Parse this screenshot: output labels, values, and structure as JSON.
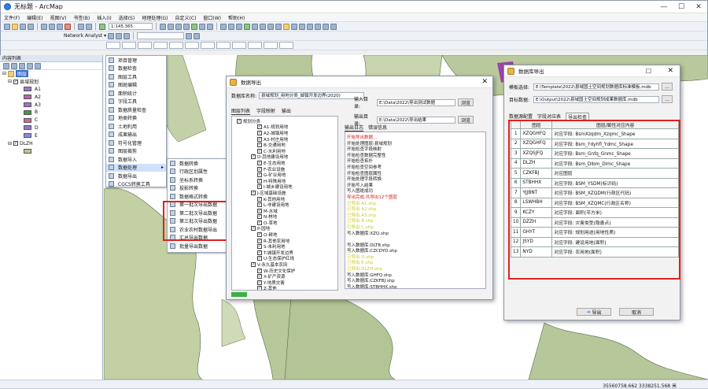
{
  "app": {
    "title": "无标题 - ArcMap",
    "window_buttons": [
      "—",
      "☐",
      "✕"
    ]
  },
  "menubar": [
    "文件(F)",
    "编辑(E)",
    "视图(V)",
    "书签(B)",
    "插入(I)",
    "选择(S)",
    "地理处理(G)",
    "自定义(C)",
    "窗口(W)",
    "帮助(H)"
  ],
  "toolbar": {
    "scale": "1:145,365",
    "network_analyst": "Network Analyst ▾"
  },
  "toc": {
    "header": "内容列表",
    "layers_group": "图层",
    "layer1": "县域规划",
    "classes": [
      {
        "label": "A1",
        "color": "#9b77c7"
      },
      {
        "label": "A2",
        "color": "#c061b7"
      },
      {
        "label": "A3",
        "color": "#9e6fd3"
      },
      {
        "label": "B",
        "color": "#3f9c43"
      },
      {
        "label": "C",
        "color": "#d06aa3"
      },
      {
        "label": "D",
        "color": "#9f73c5"
      },
      {
        "label": "E",
        "color": "#8e8bd6"
      }
    ],
    "layer2": "DLZH"
  },
  "context_menu1": {
    "items": [
      "项目管理",
      "数据检查",
      "图层工具",
      "图斑编辑",
      "面积统计",
      "字段工具",
      "数据质量检查",
      "地类转换",
      "土地利用",
      "成果输出",
      "符号化管理",
      "图层裁剪",
      "数据导入",
      "数据处理",
      "数据导出",
      "CGCS转换工具"
    ]
  },
  "context_menu2": {
    "items": [
      "数据转换",
      "行政区划属性",
      "坐标系转换",
      "投影转换",
      "数据格式转换",
      "第一批次导出数据",
      "第二批次导出数据",
      "第三批次导出数据",
      "农业农村数据导出",
      "汇总导出数据",
      "批量导出数据"
    ]
  },
  "dialog1": {
    "title": "数据导出",
    "fields": [
      {
        "label": "数据库名称:",
        "value": "县域规划_用地分类_城镇开发边界(2020)"
      },
      {
        "label": "输入目录:",
        "value": "E:\\Data\\2022\\导出测试数据"
      },
      {
        "label": "输出目录:",
        "value": "E:\\Data\\2022\\导出结果"
      }
    ],
    "browse": "浏览",
    "tabs": [
      "图层列表",
      "字段映射",
      "输出"
    ],
    "tree_items": [
      "规划分类",
      "A1-规划用地",
      "A2-城镇用地",
      "A3-村庄用地",
      "B-交通用地",
      "C-水利用地",
      "D-其他建设用地",
      "E-生态用地",
      "F-农业设施",
      "G-矿业用地",
      "H-特殊用地",
      "I-城乡建设用地",
      "J-区域基础设施",
      "K-其他用地",
      "L-非建设用地",
      "M-水域",
      "N-林地",
      "O-草地",
      "P-园地",
      "Q-耕地",
      "R-其他农用地",
      "S-未利用地",
      "T-城镇开发边界",
      "U-生态保护红线",
      "V-永久基本农田",
      "W-历史文化保护",
      "X-矿产资源",
      "Y-地质灾害",
      "Z-其他"
    ],
    "log_tabs": [
      "输出日志",
      "错误信息"
    ],
    "log_lines": [
      {
        "text": "开始导出数据...",
        "color": "#d02020"
      },
      {
        "text": "开始处理图层:县域规划",
        "color": "#111"
      },
      {
        "text": "开始检查字段映射",
        "color": "#111"
      },
      {
        "text": "开始检查数据完整性",
        "color": "#111"
      },
      {
        "text": "开始检查拓扑",
        "color": "#111"
      },
      {
        "text": "开始检查空间参考",
        "color": "#111"
      },
      {
        "text": "开始检查图层属性",
        "color": "#111"
      },
      {
        "text": "开始处理字段转换",
        "color": "#111"
      },
      {
        "text": "开始写入结果",
        "color": "#111"
      },
      {
        "text": "写入图斑成功",
        "color": "#111"
      },
      {
        "text": "导出完成:共导出12个图层",
        "color": "#d02020"
      },
      {
        "text": "已导出 A1.shp",
        "color": "#c9c92a"
      },
      {
        "text": "已导出 A2.shp",
        "color": "#c9c92a"
      },
      {
        "text": "已导出 A3.shp",
        "color": "#c9c92a"
      },
      {
        "text": "已导出 B.shp",
        "color": "#c9c92a"
      },
      {
        "text": "已导出 C.shp",
        "color": "#c9c92a"
      },
      {
        "text": "写入数据库:XZQ.shp",
        "color": "#111"
      },
      {
        "text": "",
        "color": "#111"
      },
      {
        "text": "写入数据库:DLTB.shp",
        "color": "#111"
      },
      {
        "text": "写入数据库:CZCDYD.shp",
        "color": "#111"
      },
      {
        "text": "已导出 D.shp",
        "color": "#c9c92a"
      },
      {
        "text": "已导出 E.shp",
        "color": "#c9c92a"
      },
      {
        "text": "已导出 DLZH.shp",
        "color": "#c9c92a"
      },
      {
        "text": "写入数据库:GHFQ.shp",
        "color": "#111"
      },
      {
        "text": "写入数据库:CZKFBJ.shp",
        "color": "#111"
      },
      {
        "text": "写入数据库:STBHHX.shp",
        "color": "#111"
      }
    ]
  },
  "dialog2": {
    "title": "数据库导出",
    "fields": [
      {
        "label": "模板选择:",
        "value": "E:\\Template\\2022\\县域国土空间规划数据库标准模板.mdb"
      },
      {
        "label": "目标数据:",
        "value": "E:\\Output\\2022\\县域国土空间规划成果数据库.mdb"
      }
    ],
    "browse": "...",
    "tabs": [
      "数据源配置",
      "字段对应表",
      "导出检查"
    ],
    "col_headers": [
      "图层",
      "图层/属性对应内容"
    ],
    "rows": [
      {
        "n": "1",
        "layer": "XZQGHFQ",
        "content": "对应字段: BsmXzqdm_Xzqmc_Shape"
      },
      {
        "n": "2",
        "layer": "XZQGHFQ",
        "content": "对应字段: Bsm_Ydyhfl_Ydmc_Shape"
      },
      {
        "n": "3",
        "layer": "XZQSJFQ",
        "content": "对应字段: Bsm_Gnfq_Gnmc_Shape"
      },
      {
        "n": "4",
        "layer": "DLZH",
        "content": "对应字段: Bsm_Dlbm_Dlmc_Shape"
      },
      {
        "n": "5",
        "layer": "CZKFBJ",
        "content": "对应图层"
      },
      {
        "n": "6",
        "layer": "STBHHX",
        "content": "对应字段: BSM_YSDM(标识码)"
      },
      {
        "n": "7",
        "layer": "YJJBNT",
        "content": "对应字段: BSM_XZQDM(行政区代码)"
      },
      {
        "n": "8",
        "layer": "LSWHBH",
        "content": "对应字段: BSM_XZQMC(行政区名称)"
      },
      {
        "n": "9",
        "layer": "KCZY",
        "content": "对应字段: 面积(平方米)"
      },
      {
        "n": "10",
        "layer": "DZZH",
        "content": "对应字段: 灾害类型(隐患点)"
      },
      {
        "n": "11",
        "layer": "GHYT",
        "content": "对应字段: 规划用途(用地性质)"
      },
      {
        "n": "12",
        "layer": "JSYD",
        "content": "对应字段: 建设用地(面积)"
      },
      {
        "n": "13",
        "layer": "NYD",
        "content": "对应字段: 农用地(面积)"
      }
    ],
    "ok": "导出",
    "cancel": "取消"
  },
  "status": {
    "coords": "35560758.662  3338251.568 米"
  }
}
